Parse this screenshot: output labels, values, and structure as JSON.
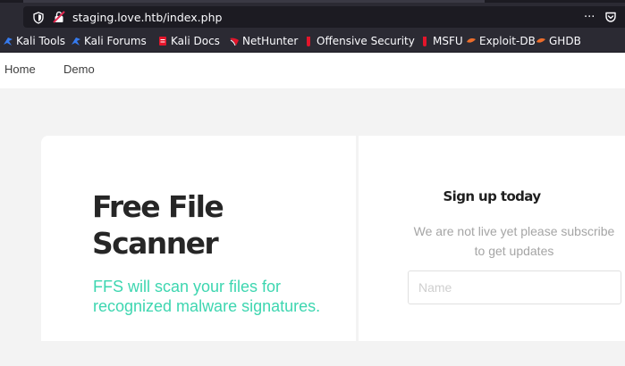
{
  "browser": {
    "url": "staging.love.htb/index.php",
    "more_label": "···",
    "bookmarks": [
      {
        "label": "Kali Tools",
        "icon": "kali-dragon-icon",
        "color": "#367bf0"
      },
      {
        "label": "Kali Forums",
        "icon": "kali-dragon-icon",
        "color": "#367bf0"
      },
      {
        "label": "Kali Docs",
        "icon": "docs-icon",
        "color": "#e4152b"
      },
      {
        "label": "NetHunter",
        "icon": "nethunter-icon",
        "color": "#e4152b"
      },
      {
        "label": "Offensive Security",
        "icon": "offsec-icon",
        "color": "#e4152b"
      },
      {
        "label": "MSFU",
        "icon": "msfu-icon",
        "color": "#e4152b"
      },
      {
        "label": "Exploit-DB",
        "icon": "exploit-db-icon",
        "color": "#ec6d2b"
      },
      {
        "label": "GHDB",
        "icon": "ghdb-icon",
        "color": "#ec6d2b"
      }
    ]
  },
  "nav": {
    "home": "Home",
    "demo": "Demo"
  },
  "hero": {
    "title": "Free File Scanner",
    "subtitle": "FFS will scan your files for recognized malware signatures."
  },
  "signup": {
    "title": "Sign up today",
    "description": "We are not live yet please subscribe to get updates",
    "name_placeholder": "Name"
  },
  "colors": {
    "accent": "#3dd6b0",
    "chrome": "#2b2a33",
    "chrome_dark": "#1c1b22"
  }
}
